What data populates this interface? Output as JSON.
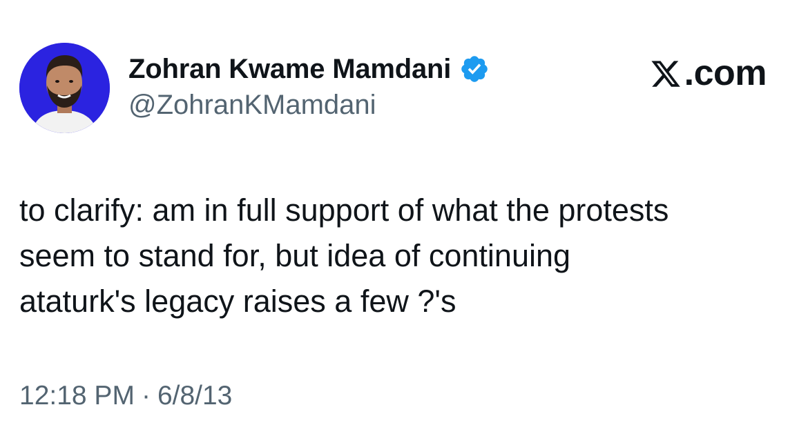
{
  "author": {
    "name": "Zohran Kwame Mamdani",
    "handle": "@ZohranKMamdani",
    "verified": true,
    "verified_color": "#1d9bf0",
    "avatar_bg_color": "#2b23e0"
  },
  "brand": {
    "label": ".com",
    "icon": "x-logo-icon"
  },
  "tweet": {
    "text": "to clarify: am in full support of what the protests\nseem to stand for, but idea of continuing\nataturk's legacy raises a few ?'s",
    "time": "12:18 PM",
    "separator": "·",
    "date": "6/8/13"
  },
  "colors": {
    "text_primary": "#0f1419",
    "text_secondary": "#536471",
    "background": "#ffffff"
  }
}
